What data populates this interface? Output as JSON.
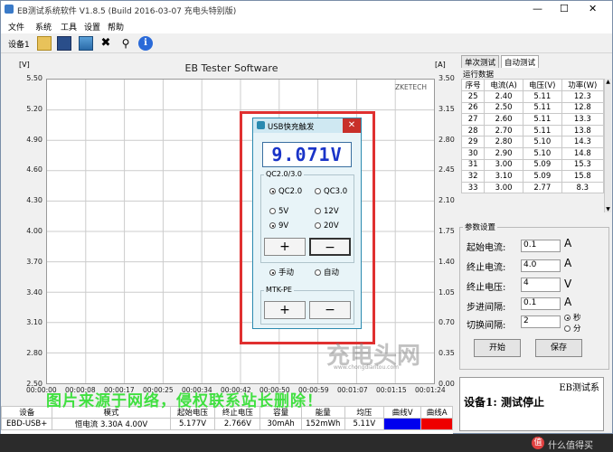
{
  "window": {
    "title": "EB测试系统软件 V1.8.5 (Build 2016-03-07 充电头特别版)"
  },
  "menu": [
    "文件",
    "系统",
    "工具",
    "设置",
    "帮助"
  ],
  "toolbar": {
    "device_label": "设备1",
    "icons": [
      "folder-open-icon",
      "save-icon",
      "chart-icon",
      "tools-icon",
      "search-icon",
      "info-icon"
    ]
  },
  "chart": {
    "title": "EB Tester Software",
    "left_unit": "[V]",
    "right_unit": "[A]",
    "brand": "ZKETECH",
    "left_ticks": [
      "5.50",
      "5.20",
      "4.90",
      "4.60",
      "4.30",
      "4.00",
      "3.70",
      "3.40",
      "3.10",
      "2.80",
      "2.50"
    ],
    "right_ticks": [
      "3.50",
      "3.15",
      "2.80",
      "2.45",
      "2.10",
      "1.75",
      "1.40",
      "1.05",
      "0.70",
      "0.35",
      "0.00"
    ],
    "x_ticks": [
      "00:00:00",
      "00:00:08",
      "00:00:17",
      "00:00:25",
      "00:00:34",
      "00:00:42",
      "00:00:50",
      "00:00:59",
      "00:01:07",
      "00:01:15",
      "00:01:24"
    ]
  },
  "right_panel": {
    "tabs": [
      "单次测试",
      "自动测试"
    ],
    "active_tab": 1,
    "data_group_label": "运行数据",
    "table_headers": [
      "序号",
      "电流(A)",
      "电压(V)",
      "功率(W)"
    ],
    "rows": [
      [
        "25",
        "2.40",
        "5.11",
        "12.3"
      ],
      [
        "26",
        "2.50",
        "5.11",
        "12.8"
      ],
      [
        "27",
        "2.60",
        "5.11",
        "13.3"
      ],
      [
        "28",
        "2.70",
        "5.11",
        "13.8"
      ],
      [
        "29",
        "2.80",
        "5.10",
        "14.3"
      ],
      [
        "30",
        "2.90",
        "5.10",
        "14.8"
      ],
      [
        "31",
        "3.00",
        "5.09",
        "15.3"
      ],
      [
        "32",
        "3.10",
        "5.09",
        "15.8"
      ],
      [
        "33",
        "3.00",
        "2.77",
        "8.3"
      ]
    ],
    "params_label": "参数设置",
    "params": [
      {
        "label": "起始电流:",
        "value": "0.1",
        "unit": "A"
      },
      {
        "label": "终止电流:",
        "value": "4.0",
        "unit": "A"
      },
      {
        "label": "终止电压:",
        "value": "4",
        "unit": "V"
      },
      {
        "label": "步进间隔:",
        "value": "0.1",
        "unit": "A"
      },
      {
        "label": "切换间隔:",
        "value": "2",
        "unit": ""
      }
    ],
    "sec_label": "秒",
    "min_label": "分",
    "start_button": "开始",
    "save_button": "保存"
  },
  "dialog": {
    "title": "USB快充触发",
    "close": "✕",
    "display": "9.071V",
    "group1_label": "QC2.0/3.0",
    "qc20": "QC2.0",
    "qc30": "QC3.0",
    "v5": "5V",
    "v12": "12V",
    "v9": "9V",
    "v20": "20V",
    "plus": "+",
    "minus": "−",
    "manual": "手动",
    "auto": "自动",
    "group2_label": "MTK-PE",
    "plus2": "+",
    "minus2": "−"
  },
  "bottom_table": {
    "headers": [
      "设备",
      "模式",
      "起始电压",
      "终止电压",
      "容量",
      "能量",
      "均压",
      "曲线V",
      "曲线A"
    ],
    "row": [
      "EBD-USB+",
      "恒电流 3.30A 4.00V",
      "5.177V",
      "2.766V",
      "30mAh",
      "152mWh",
      "5.11V",
      "",
      ""
    ]
  },
  "status": {
    "header": "EB测试系",
    "text": "设备1: 测试停止"
  },
  "watermark": {
    "text": "图片来源于网络，侵权联系站长删除！",
    "logo": "充电头网",
    "url": "www.chongdiantou.com",
    "site": "什么值得买"
  },
  "colors": {
    "curve_v": "#0000ee",
    "curve_a": "#ee0000",
    "highlight": "#e03030",
    "lcd": "#1a34c8",
    "watermark": "#40e040"
  }
}
